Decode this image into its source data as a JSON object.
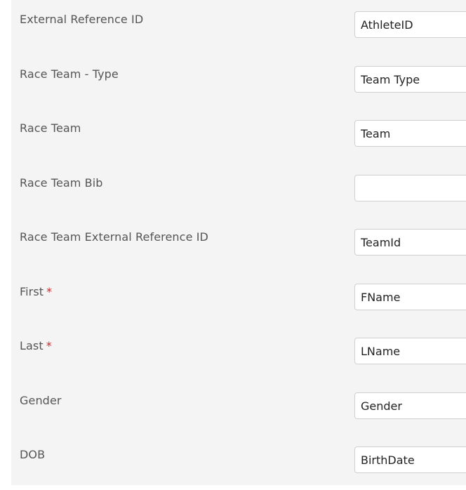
{
  "form": {
    "fields": [
      {
        "label": "External Reference ID",
        "value": "AthleteID",
        "required": false
      },
      {
        "label": "Race Team - Type",
        "value": "Team Type",
        "required": false
      },
      {
        "label": "Race Team",
        "value": "Team",
        "required": false
      },
      {
        "label": "Race Team Bib",
        "value": "",
        "required": false
      },
      {
        "label": "Race Team External Reference ID",
        "value": "TeamId",
        "required": false
      },
      {
        "label": "First",
        "value": "FName",
        "required": true
      },
      {
        "label": "Last",
        "value": "LName",
        "required": true
      },
      {
        "label": "Gender",
        "value": "Gender",
        "required": false
      },
      {
        "label": "DOB",
        "value": "BirthDate",
        "required": false
      }
    ],
    "required_marker": "*"
  }
}
